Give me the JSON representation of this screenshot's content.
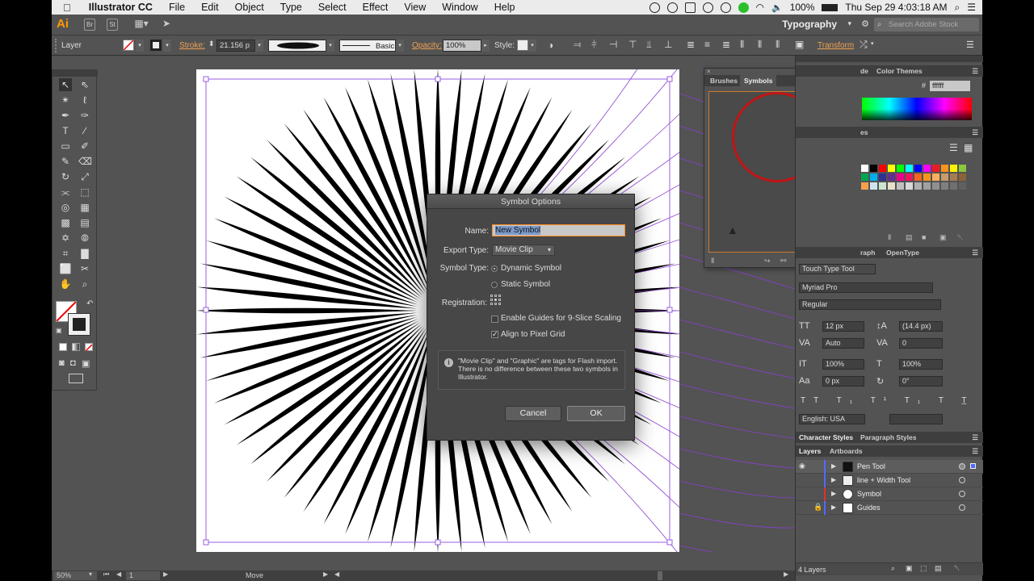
{
  "menubar": {
    "app_name": "Illustrator CC",
    "items": [
      "File",
      "Edit",
      "Object",
      "Type",
      "Select",
      "Effect",
      "View",
      "Window",
      "Help"
    ],
    "battery": "100%",
    "clock": "Thu Sep 29  4:03:18 AM"
  },
  "appbar": {
    "logo": "Ai",
    "btn_bridge": "Br",
    "btn_stock": "St",
    "workspace": "Typography",
    "search_placeholder": "Search Adobe Stock"
  },
  "controlbar": {
    "selection_label": "Layer",
    "stroke_label": "Stroke:",
    "stroke_value": "21.156 p",
    "brush_label": "Basic",
    "opacity_label": "Opacity:",
    "opacity_value": "100%",
    "style_label": "Style:",
    "transform_label": "Transform"
  },
  "statusbar": {
    "zoom": "50%",
    "artboard": "1",
    "tool": "Move"
  },
  "dialog": {
    "title": "Symbol Options",
    "name_label": "Name:",
    "name_value": "New Symbol",
    "export_type_label": "Export Type:",
    "export_type_value": "Movie Clip",
    "symbol_type_label": "Symbol Type:",
    "dynamic_label": "Dynamic Symbol",
    "static_label": "Static Symbol",
    "registration_label": "Registration:",
    "slice_label": "Enable Guides for 9-Slice Scaling",
    "pixel_grid_label": "Align to Pixel Grid",
    "info_text": "\"Movie Clip\" and \"Graphic\" are tags for Flash import. There is no difference between these two symbols in Illustrator.",
    "cancel_label": "Cancel",
    "ok_label": "OK"
  },
  "symbols_panel": {
    "tab_brushes": "Brushes",
    "tab_symbols": "Symbols"
  },
  "right_panels": {
    "color_tab_partial": "de",
    "color_themes_tab": "Color Themes",
    "hex_value": "ffffff",
    "swatches_partial": "es",
    "graph_partial": "raph",
    "opentype_tab": "OpenType",
    "touch_type": "Touch Type Tool",
    "font_family": "Myriad Pro",
    "font_style": "Regular",
    "font_size": "12 px",
    "leading": "(14.4 px)",
    "kerning": "Auto",
    "tracking": "0",
    "vscale": "100%",
    "hscale": "100%",
    "baseline": "0 px",
    "rotation": "0°",
    "language": "English: USA",
    "char_styles_tab": "Character Styles",
    "para_styles_tab": "Paragraph Styles",
    "layers_tab": "Layers",
    "artboards_tab": "Artboards",
    "layers": [
      {
        "name": "Pen Tool",
        "color": "#4f6bff"
      },
      {
        "name": "line + Width Tool",
        "color": "#4f6bff"
      },
      {
        "name": "Symbol",
        "color": "#e03030"
      },
      {
        "name": "Guides",
        "color": "#4f6bff"
      }
    ],
    "layer_count": "4 Layers"
  },
  "colors": {
    "accent_orange": "#f0a050",
    "symbol_ring": "#c01515",
    "guide_purple": "#8a3fd1"
  }
}
